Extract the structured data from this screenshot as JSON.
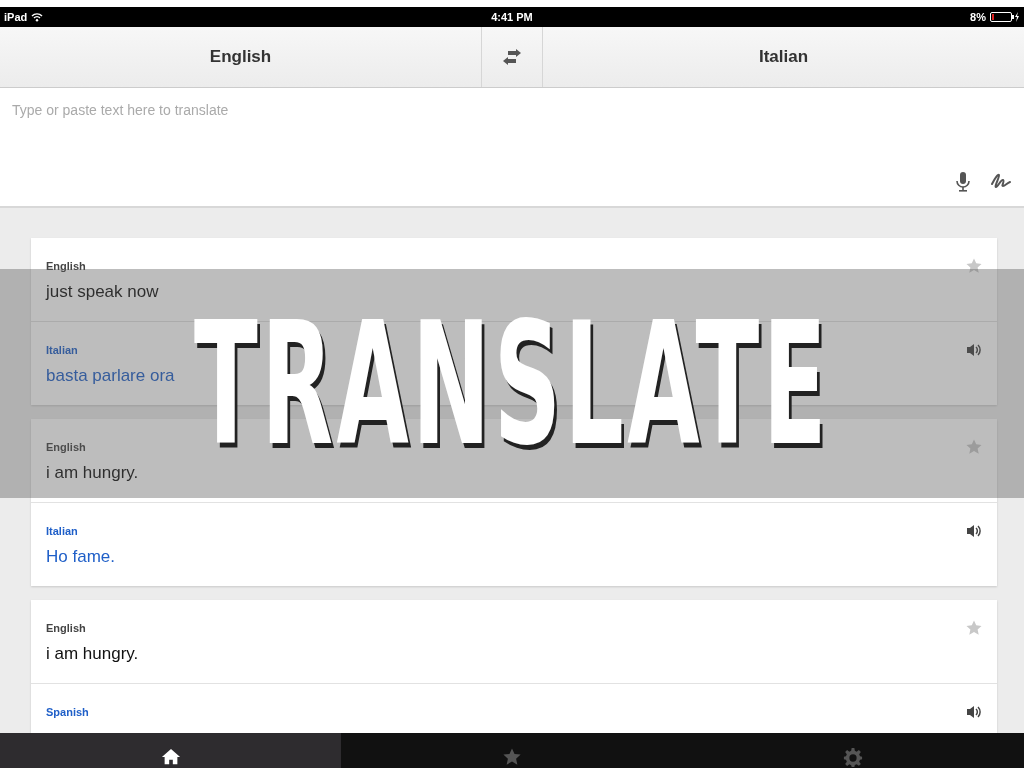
{
  "status_bar": {
    "device": "iPad",
    "time": "4:41 PM",
    "battery": "8%"
  },
  "language_bar": {
    "source": "English",
    "target": "Italian"
  },
  "input": {
    "placeholder": "Type or paste text here to translate"
  },
  "translations": [
    {
      "starred": false,
      "source": {
        "language": "English",
        "text": "just speak now"
      },
      "target": {
        "language": "Italian",
        "text": "basta parlare ora"
      }
    },
    {
      "starred": false,
      "source": {
        "language": "English",
        "text": "i am hungry."
      },
      "target": {
        "language": "Italian",
        "text": "Ho fame."
      }
    },
    {
      "starred": false,
      "source": {
        "language": "English",
        "text": "i am hungry."
      },
      "target": {
        "language": "Spanish"
      }
    }
  ],
  "tab_bar": [
    {
      "kind": "home",
      "selected": true
    },
    {
      "kind": "star",
      "selected": false
    },
    {
      "kind": "settings",
      "selected": false
    }
  ],
  "banner": {
    "title": "TRANSLATE"
  }
}
